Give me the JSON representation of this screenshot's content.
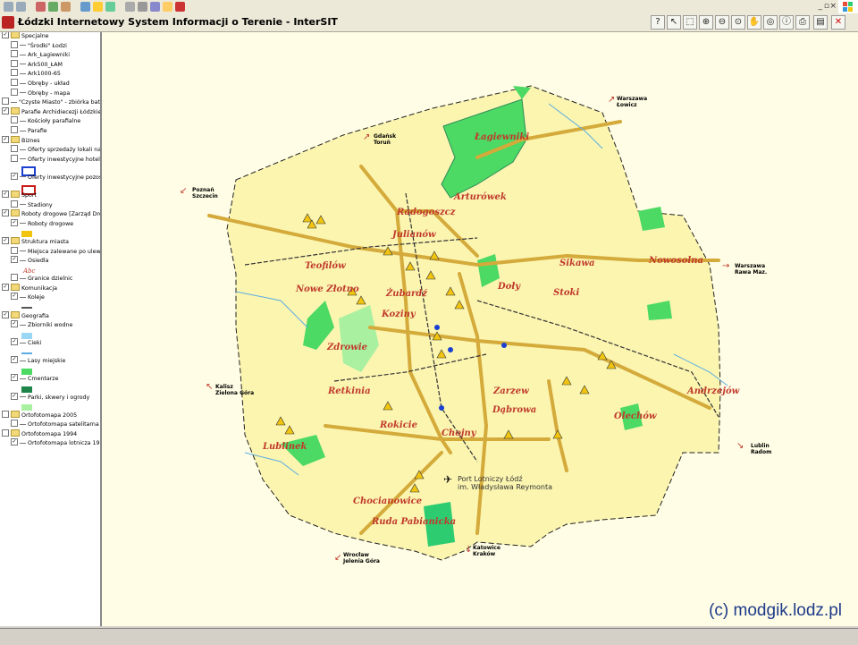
{
  "window": {
    "title": "Łódzki Internetowy System Informacji o Terenie - InterSIT",
    "controls": [
      "_",
      "▫",
      "×"
    ]
  },
  "layers": [
    {
      "label": "Specjalne",
      "checked": true,
      "kind": "group",
      "indent": 0
    },
    {
      "label": "\"Środki\" Łodzi",
      "checked": false,
      "kind": "line",
      "indent": 1
    },
    {
      "label": "Ark_Łagiewniki",
      "checked": false,
      "kind": "line",
      "indent": 1
    },
    {
      "label": "Ark500_ŁAM",
      "checked": false,
      "kind": "line",
      "indent": 1
    },
    {
      "label": "Ark1000-65",
      "checked": false,
      "kind": "line",
      "indent": 1
    },
    {
      "label": "Obręby - układ",
      "checked": false,
      "kind": "line",
      "indent": 1
    },
    {
      "label": "Obręby - mapa",
      "checked": false,
      "kind": "line",
      "indent": 1
    },
    {
      "label": "\"Czyste Miasto\" - zbiórka bate",
      "checked": false,
      "kind": "line",
      "indent": 0
    },
    {
      "label": "Parafie Archidiecezji Łódzkiej",
      "checked": true,
      "kind": "group",
      "indent": 0
    },
    {
      "label": "Kościoły parafialne",
      "checked": false,
      "kind": "line",
      "indent": 1
    },
    {
      "label": "Parafie",
      "checked": false,
      "kind": "line",
      "indent": 1
    },
    {
      "label": "Biznes",
      "checked": true,
      "kind": "group",
      "indent": 0
    },
    {
      "label": "Oferty sprzedaży lokali na",
      "checked": false,
      "kind": "line",
      "indent": 1
    },
    {
      "label": "Oferty inwestycyjne hotelo",
      "checked": false,
      "kind": "line",
      "indent": 1
    },
    {
      "label": "",
      "checked": null,
      "kind": "swatch",
      "indent": 1
    },
    {
      "label": "Oferty inwestycyjne pozos",
      "checked": true,
      "kind": "line",
      "indent": 1
    },
    {
      "label": "",
      "checked": null,
      "kind": "swatch",
      "indent": 1
    },
    {
      "label": "Sport",
      "checked": true,
      "kind": "group",
      "indent": 0
    },
    {
      "label": "Stadiony",
      "checked": false,
      "kind": "line",
      "indent": 1
    },
    {
      "label": "Roboty drogowe [Zarząd Dróg",
      "checked": true,
      "kind": "group",
      "indent": 0
    },
    {
      "label": "Roboty drogowe",
      "checked": true,
      "kind": "line",
      "indent": 1
    },
    {
      "label": "",
      "checked": null,
      "kind": "swatch",
      "indent": 1
    },
    {
      "label": "Struktura miasta",
      "checked": true,
      "kind": "group",
      "indent": 0
    },
    {
      "label": "Miejsca zalewane po ulew",
      "checked": false,
      "kind": "line",
      "indent": 1
    },
    {
      "label": "Osiedla",
      "checked": true,
      "kind": "line",
      "indent": 1
    },
    {
      "label": "Abc",
      "checked": null,
      "kind": "swatch",
      "indent": 1
    },
    {
      "label": "Granice dzielnic",
      "checked": false,
      "kind": "line",
      "indent": 1
    },
    {
      "label": "Komunikacja",
      "checked": true,
      "kind": "group",
      "indent": 0
    },
    {
      "label": "Koleje",
      "checked": true,
      "kind": "line",
      "indent": 1
    },
    {
      "label": "",
      "checked": null,
      "kind": "swatch",
      "indent": 1
    },
    {
      "label": "Geografia",
      "checked": true,
      "kind": "group",
      "indent": 0
    },
    {
      "label": "Zbiorniki wodne",
      "checked": true,
      "kind": "line",
      "indent": 1
    },
    {
      "label": "",
      "checked": null,
      "kind": "swatch",
      "indent": 1
    },
    {
      "label": "Cieki",
      "checked": true,
      "kind": "line",
      "indent": 1
    },
    {
      "label": "",
      "checked": null,
      "kind": "swatch",
      "indent": 1
    },
    {
      "label": "Lasy miejskie",
      "checked": true,
      "kind": "line",
      "indent": 1
    },
    {
      "label": "",
      "checked": null,
      "kind": "swatch",
      "indent": 1
    },
    {
      "label": "Cmentarze",
      "checked": true,
      "kind": "line",
      "indent": 1
    },
    {
      "label": "",
      "checked": null,
      "kind": "swatch",
      "indent": 1
    },
    {
      "label": "Parki, skwery i ogrody",
      "checked": true,
      "kind": "line",
      "indent": 1
    },
    {
      "label": "",
      "checked": null,
      "kind": "swatch",
      "indent": 1
    },
    {
      "label": "Ortofotomapa 2005",
      "checked": false,
      "kind": "group",
      "indent": 0
    },
    {
      "label": "Ortofotomapa satelitarna 2",
      "checked": false,
      "kind": "line",
      "indent": 1
    },
    {
      "label": "Ortofotomapa 1994",
      "checked": false,
      "kind": "group",
      "indent": 0
    },
    {
      "label": "Ortofotomapa lotnicza 199",
      "checked": true,
      "kind": "line",
      "indent": 1
    }
  ],
  "districts": [
    "Łagiewniki",
    "Arturówek",
    "Radogoszcz",
    "Julianów",
    "Teofilów",
    "Nowe Złotno",
    "Żubardź",
    "Koziny",
    "Doły",
    "Stoki",
    "Sikawa",
    "Nowosolna",
    "Zdrowie",
    "Retkinia",
    "Zarzew",
    "Dąbrowa",
    "Andrzejów",
    "Olechów",
    "Rokicie",
    "Chojny",
    "Lublinek",
    "Chocianowice",
    "Ruda Pabianicka"
  ],
  "destinations": [
    {
      "line1": "Warszawa",
      "line2": "Łowicz",
      "arrow": "↗"
    },
    {
      "line1": "Gdańsk",
      "line2": "Toruń",
      "arrow": "↗"
    },
    {
      "line1": "Poznań",
      "line2": "Szczecin",
      "arrow": "↙"
    },
    {
      "line1": "Warszawa",
      "line2": "Rawa Maz.",
      "arrow": "→"
    },
    {
      "line1": "Kalisz",
      "line2": "Zielona Góra",
      "arrow": "↖"
    },
    {
      "line1": "Lublin",
      "line2": "Radom",
      "arrow": "↘"
    },
    {
      "line1": "Wrocław",
      "line2": "Jelenia Góra",
      "arrow": "↙"
    },
    {
      "line1": "Katowice",
      "line2": "Kraków",
      "arrow": "↓"
    }
  ],
  "airport": {
    "line1": "Port Lotniczy Łódź",
    "line2": "im. Władysława Reymonta"
  },
  "legend_text": "Abc",
  "copyright": "(c) modgik.lodz.pl",
  "colors": {
    "map_bg": "#fffde5",
    "city": "#fbf5b0",
    "forest": "#4cd964",
    "road": "#d4aa3b",
    "label": "#c0392b",
    "border": "#555555"
  }
}
